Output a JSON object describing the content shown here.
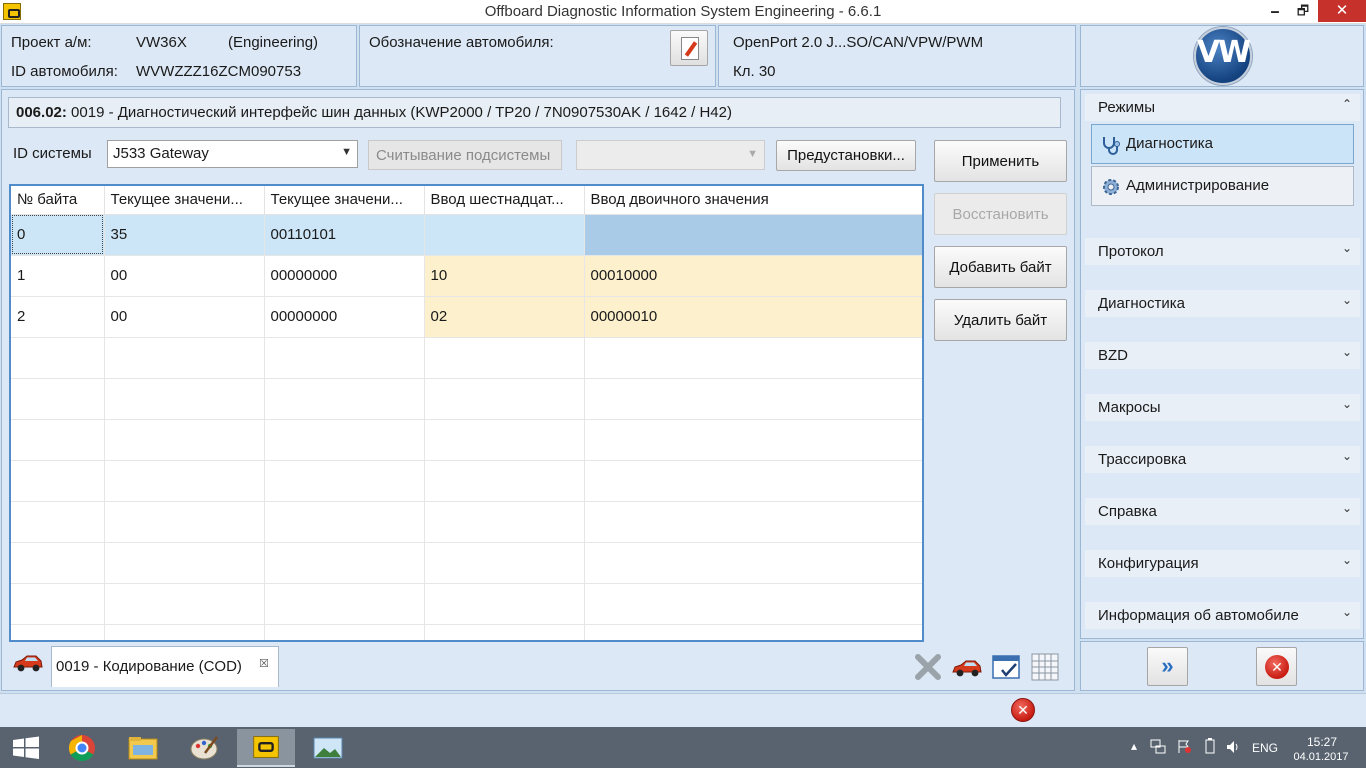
{
  "window": {
    "title": "Offboard Diagnostic Information System Engineering - 6.6.1",
    "minimize": "🗕",
    "maximize": "🗗",
    "close": "✕"
  },
  "header": {
    "project_label": "Проект а/м:",
    "project_value": "VW36X",
    "project_mode": "(Engineering)",
    "vin_label": "ID автомобиля:",
    "vin_value": "WVWZZZ16ZCM090753",
    "designation_label": "Обозначение автомобиля:",
    "interface": "OpenPort 2.0 J...SO/CAN/VPW/PWM",
    "terminal": "Кл. 30",
    "logo_text": "VW"
  },
  "info_bar": {
    "code": "006.02:",
    "text": "0019 - Диагностический интерфейс шин данных  (KWP2000 / TP20 / 7N0907530AK / 1642 / H42)"
  },
  "controls": {
    "system_id_label": "ID системы",
    "system_id_value": "J533  Gateway",
    "read_subsystem": "Считывание подсистемы",
    "presets": "Предустановки...",
    "apply": "Применить",
    "restore": "Восстановить",
    "add_byte": "Добавить байт",
    "delete_byte": "Удалить байт"
  },
  "grid": {
    "columns": [
      "№ байта",
      "Текущее значени...",
      "Текущее значени...",
      "Ввод шестнадцат...",
      "Ввод двоичного значения"
    ],
    "rows": [
      [
        "0",
        "35",
        "00110101",
        "",
        ""
      ],
      [
        "1",
        "00",
        "00000000",
        "10",
        "00010000"
      ],
      [
        "2",
        "00",
        "00000000",
        "02",
        "00000010"
      ]
    ],
    "empty_rows": 8
  },
  "tabs": {
    "coding_tab": "0019 - Кодирование (COD)",
    "close_glyph": "☒"
  },
  "side": {
    "modes_title": "Режимы",
    "mode_diagnostics": "Диагностика",
    "mode_admin": "Администрирование",
    "sections": [
      "Протокол",
      "Диагностика",
      "BZD",
      "Макросы",
      "Трассировка",
      "Справка",
      "Конфигурация",
      "Информация об автомобиле"
    ],
    "collapse_glyph": "⌃",
    "expand_glyph": "⌄"
  },
  "status": {
    "error_glyph": "✕"
  },
  "taskbar": {
    "language": "ENG",
    "time": "15:27",
    "date": "04.01.2017"
  },
  "colors": {
    "panel": "#dce8f5",
    "selection": "#cde6f7",
    "edited_cell": "#fcf1cc",
    "grid_border": "#4f8cc9",
    "taskbar": "#58636f"
  }
}
